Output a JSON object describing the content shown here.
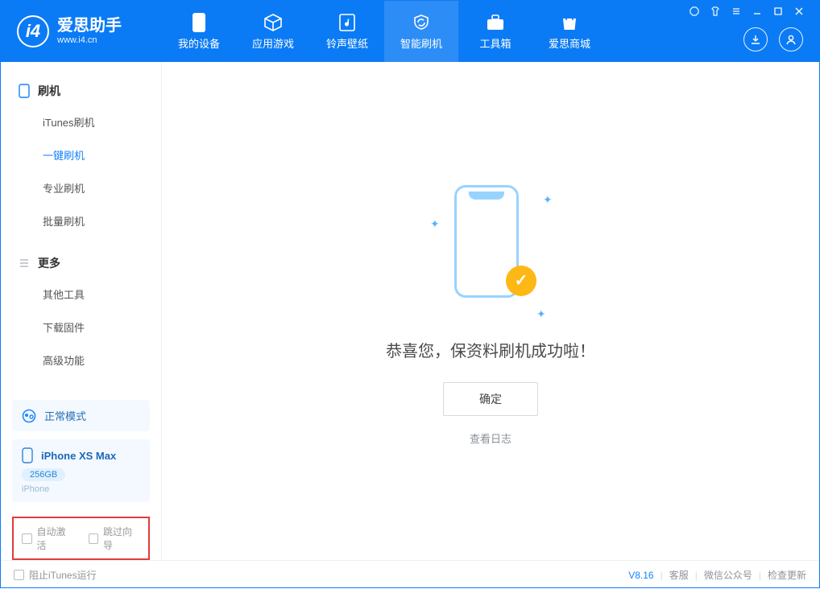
{
  "brand": {
    "cn": "爱思助手",
    "url": "www.i4.cn"
  },
  "nav": [
    {
      "label": "我的设备"
    },
    {
      "label": "应用游戏"
    },
    {
      "label": "铃声壁纸"
    },
    {
      "label": "智能刷机"
    },
    {
      "label": "工具箱"
    },
    {
      "label": "爱思商城"
    }
  ],
  "sidebar": {
    "group1_title": "刷机",
    "group2_title": "更多",
    "items1": [
      {
        "label": "iTunes刷机"
      },
      {
        "label": "一键刷机"
      },
      {
        "label": "专业刷机"
      },
      {
        "label": "批量刷机"
      }
    ],
    "items2": [
      {
        "label": "其他工具"
      },
      {
        "label": "下载固件"
      },
      {
        "label": "高级功能"
      }
    ]
  },
  "mode": {
    "label": "正常模式"
  },
  "device": {
    "name": "iPhone XS Max",
    "storage": "256GB",
    "type": "iPhone"
  },
  "options": {
    "auto_activate": "自动激活",
    "skip_guide": "跳过向导"
  },
  "main": {
    "message": "恭喜您，保资料刷机成功啦！",
    "ok": "确定",
    "log": "查看日志"
  },
  "status": {
    "block_itunes": "阻止iTunes运行",
    "version": "V8.16",
    "customer_service": "客服",
    "wechat": "微信公众号",
    "check_update": "检查更新"
  }
}
